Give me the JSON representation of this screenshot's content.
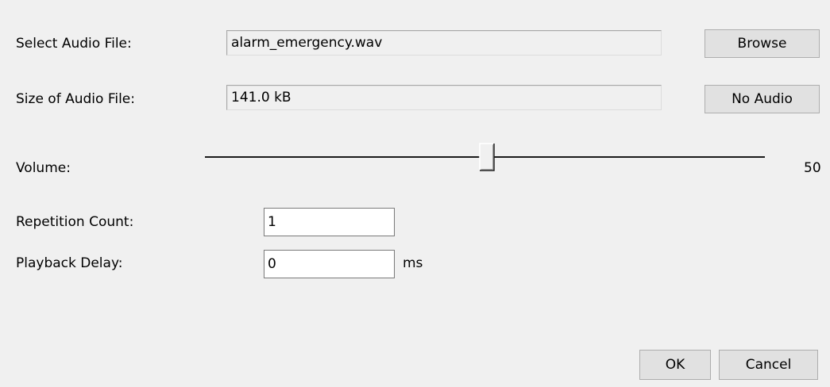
{
  "audio_file": {
    "label": "Select Audio File:",
    "value": "alarm_emergency.wav",
    "browse_label": "Browse"
  },
  "audio_size": {
    "label": "Size of Audio File:",
    "value": "141.0 kB",
    "no_audio_label": "No Audio"
  },
  "volume": {
    "label": "Volume:",
    "value": "50",
    "min": 0,
    "max": 100
  },
  "repetition": {
    "label": "Repetition Count:",
    "value": "1"
  },
  "delay": {
    "label": "Playback Delay:",
    "value": "0",
    "unit": "ms"
  },
  "footer": {
    "ok_label": "OK",
    "cancel_label": "Cancel"
  }
}
